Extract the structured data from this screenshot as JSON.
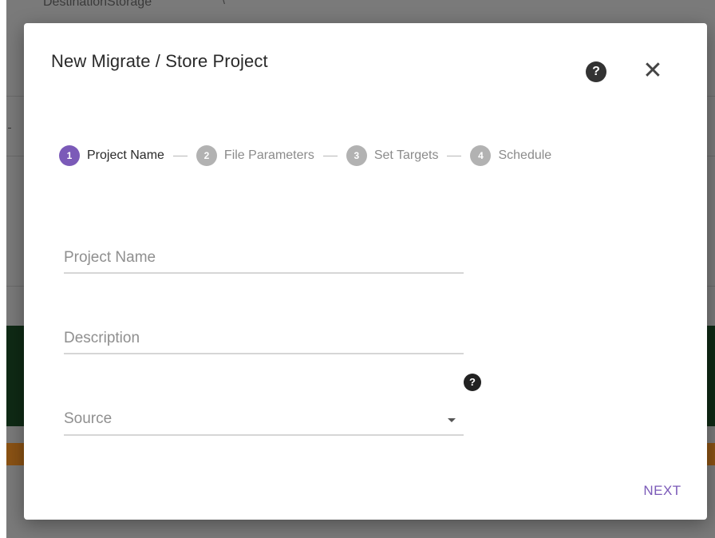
{
  "background": {
    "top_text": "DestinationStorage",
    "top_chevron": "\\"
  },
  "dialog": {
    "title": "New Migrate / Store Project",
    "help_icon": "?",
    "close_icon": "✕"
  },
  "stepper": {
    "steps": [
      {
        "num": "1",
        "label": "Project Name",
        "state": "active"
      },
      {
        "num": "2",
        "label": "File Parameters",
        "state": "inactive"
      },
      {
        "num": "3",
        "label": "Set Targets",
        "state": "inactive"
      },
      {
        "num": "4",
        "label": "Schedule",
        "state": "inactive"
      }
    ],
    "active_color": "#7b5ab8",
    "inactive_color": "#b2b2b2"
  },
  "form": {
    "project_name": {
      "placeholder": "Project Name",
      "value": ""
    },
    "description": {
      "placeholder": "Description",
      "value": ""
    },
    "source": {
      "label": "Source",
      "help_icon": "?"
    }
  },
  "actions": {
    "next_label": "NEXT"
  },
  "colors": {
    "accent": "#7b5ab8"
  }
}
